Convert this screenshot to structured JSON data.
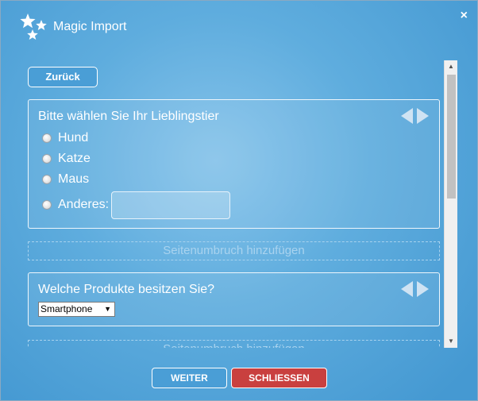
{
  "dialog": {
    "title": "Magic Import",
    "close_symbol": "×",
    "logo_icon": "stars-icon"
  },
  "toolbar": {
    "back_label": "Zurück"
  },
  "questions": [
    {
      "title": "Bitte wählen Sie Ihr Lieblingstier",
      "options": [
        "Hund",
        "Katze",
        "Maus",
        "Anderes:"
      ],
      "other_value": ""
    },
    {
      "title": "Welche Produkte besitzen Sie?",
      "selected_value": "Smartphone"
    }
  ],
  "page_break_label": "Seitenumbruch hinzufügen",
  "footer": {
    "next_label": "WEITER",
    "close_label": "SCHLIESSEN"
  },
  "colors": {
    "accent": "#4a9ed6",
    "danger": "#c9403f"
  }
}
